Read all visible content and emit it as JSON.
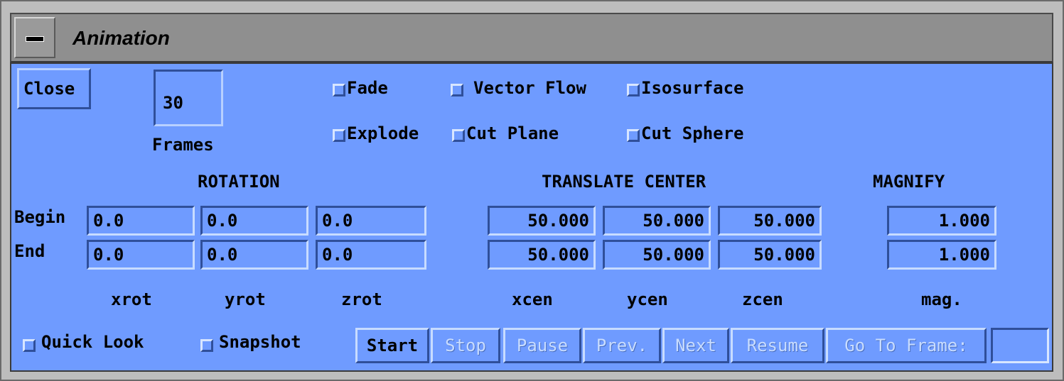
{
  "window": {
    "title": "Animation",
    "colors": {
      "panel": "#6f9bff",
      "titlebar": "#8f8f8f"
    }
  },
  "controls": {
    "close_label": "Close",
    "frames_value": "30",
    "frames_label": "Frames"
  },
  "options": {
    "fade": "Fade",
    "vector_flow": "Vector Flow",
    "isosurface": "Isosurface",
    "explode": "Explode",
    "cut_plane": "Cut Plane",
    "cut_sphere": "Cut Sphere"
  },
  "sections": {
    "rotation": "ROTATION",
    "translate": "TRANSLATE CENTER",
    "magnify": "MAGNIFY"
  },
  "rows": {
    "begin": "Begin",
    "end": "End"
  },
  "rotation": {
    "begin": [
      "0.0",
      "0.0",
      "0.0"
    ],
    "end": [
      "0.0",
      "0.0",
      "0.0"
    ]
  },
  "translate": {
    "begin": [
      "50.000",
      "50.000",
      "50.000"
    ],
    "end": [
      "50.000",
      "50.000",
      "50.000"
    ]
  },
  "magnify": {
    "begin": "1.000",
    "end": "1.000"
  },
  "column_labels": {
    "xrot": "xrot",
    "yrot": "yrot",
    "zrot": "zrot",
    "xcen": "xcen",
    "ycen": "ycen",
    "zcen": "zcen",
    "mag": "mag."
  },
  "bottom": {
    "quick_look": "Quick Look",
    "snapshot": "Snapshot",
    "start": "Start",
    "stop": "Stop",
    "pause": "Pause",
    "prev": "Prev.",
    "next": "Next",
    "resume": "Resume",
    "go_to_frame": "Go To Frame:",
    "go_to_frame_value": ""
  }
}
